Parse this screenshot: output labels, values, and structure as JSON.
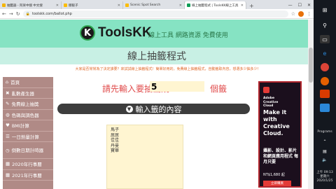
{
  "browser": {
    "tabs": [
      {
        "label": "抽籤器 - 阿呆中搜 中文搜",
        "favicon_color": "#f4b400",
        "active": false
      },
      {
        "label": "擲骰子",
        "favicon_color": "#fbbc05",
        "active": false
      },
      {
        "label": "Scenic Spot Search",
        "favicon_color": "#fbbc05",
        "active": false
      },
      {
        "label": "線上抽籤程式 | ToolsKK線上工具",
        "favicon_color": "#0f9d58",
        "active": true
      }
    ],
    "new_tab_label": "+",
    "url": "toolskk.com/ballot.php"
  },
  "site": {
    "logo_letter": "K",
    "logo_text": "ToolsKK",
    "slogan": "線上工具 網路資源 免費使用",
    "page_title": "線上抽籤程式",
    "intro": "大家是否常常為了決定誰要？來試試線上抽籤程式！簡單好用的，免費線上抽籤程式，自動籤取內容，想選多少抽多少！"
  },
  "sidebar": {
    "items": [
      {
        "icon": "⌂",
        "label": "首頁"
      },
      {
        "icon": "✖",
        "label": "亂數產生器"
      },
      {
        "icon": "✎",
        "label": "免費線上抽獎"
      },
      {
        "icon": "◍",
        "label": "色碼與調色器"
      },
      {
        "icon": "♥",
        "label": "BMI計算"
      },
      {
        "icon": "☰",
        "label": "一日熱量計算"
      },
      {
        "icon": "◷",
        "label": "倒數日期計時器"
      },
      {
        "icon": "▦",
        "label": "2020年行事曆"
      },
      {
        "icon": "▦",
        "label": "2021年行事曆"
      }
    ]
  },
  "form": {
    "prompt": "請先輸入要抽出幾",
    "count_value": "5",
    "unit": "個籤",
    "section_label": "輸入籤的內容",
    "entries": [
      "馬子",
      "居居",
      "佳佳",
      "丹曼",
      "寶華"
    ]
  },
  "ad": {
    "brand": "Adobe Creative Cloud",
    "headline": "Make it with Creative Cloud.",
    "subtext": "攝影、設計、影片和網頁應用程式 每月只要",
    "price": "NT$1,680 起",
    "button": "立即購買"
  },
  "taskbar": {
    "label": "Programs",
    "time": "上午 09:13",
    "day": "星期六",
    "date": "2020/1/25"
  }
}
